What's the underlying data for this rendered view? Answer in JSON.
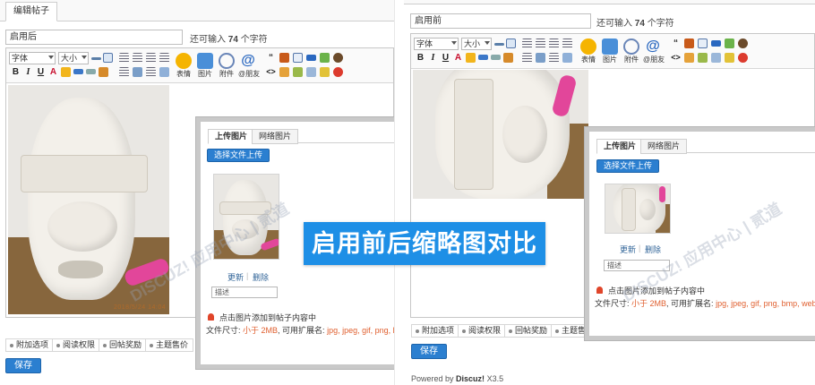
{
  "left": {
    "tab_label": "编辑帖子",
    "subject": "启用后",
    "remain_prefix": "还可输入",
    "remain_count": "74",
    "remain_suffix": "个字符",
    "font_select": "字体",
    "size_select": "大小",
    "big_buttons": [
      "表情",
      "图片",
      "附件",
      "@朋友"
    ],
    "photo_date": "2018/5/24  14:04",
    "dialog": {
      "tab_upload": "上传图片",
      "tab_network": "网络图片",
      "upload_button": "选择文件上传",
      "update_link": "更新",
      "delete_link": "删除",
      "desc_placeholder": "描述",
      "hint_click": "点击图片添加到帖子内容中",
      "hint_size_label": "文件尺寸:",
      "hint_size_value": "小于 2MB",
      "hint_ext_label": ", 可用扩展名:",
      "hint_ext_value": "jpg, jpeg, gif, png, bmp, w"
    },
    "options": [
      "附加选项",
      "阅读权限",
      "回帖奖励",
      "主题售价"
    ],
    "save_button": "保存"
  },
  "right": {
    "subject": "启用前",
    "remain_prefix": "还可输入",
    "remain_count": "74",
    "remain_suffix": "个字符",
    "font_select": "字体",
    "size_select": "大小",
    "big_buttons": [
      "表情",
      "图片",
      "附件",
      "@朋友"
    ],
    "dialog": {
      "tab_upload": "上传图片",
      "tab_network": "网络图片",
      "upload_button": "选择文件上传",
      "update_link": "更新",
      "delete_link": "删除",
      "desc_placeholder": "描述",
      "hint_click": "点击图片添加到帖子内容中",
      "hint_size_label": "文件尺寸:",
      "hint_size_value": "小于 2MB",
      "hint_ext_label": ", 可用扩展名:",
      "hint_ext_value": "jpg, jpeg, gif, png, bmp, webp"
    },
    "options": [
      "附加选项",
      "阅读权限",
      "回帖奖励",
      "主题售价"
    ],
    "save_button": "保存",
    "powered_prefix": "Powered by",
    "powered_brand": "Discuz!",
    "powered_version": "X3.5"
  },
  "banner": "启用前后缩略图对比",
  "watermark": "DISCUZ! 应用中心 | 贰道",
  "colors": {
    "accent_blue": "#2b7fd0",
    "banner_blue": "#1e8fe6",
    "hint_red": "#e06030",
    "mask_pink": "#e2469a"
  }
}
